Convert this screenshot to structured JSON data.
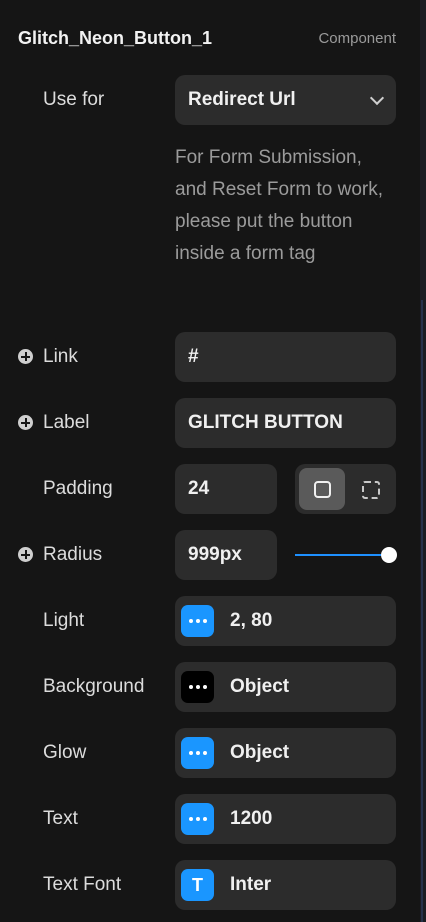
{
  "header": {
    "title": "Glitch_Neon_Button_1",
    "kind": "Component"
  },
  "use_for": {
    "label": "Use for",
    "value": "Redirect Url",
    "icon": "chevron-down-icon"
  },
  "help_text": "For Form Submission, and Reset Form to work, please put the button inside a form tag",
  "link": {
    "label": "Link",
    "value": "#"
  },
  "label_prop": {
    "label": "Label",
    "value": "GLITCH BUTTON"
  },
  "padding": {
    "label": "Padding",
    "value": "24",
    "toggle_icons": [
      "rounded-square-icon",
      "dashed-square-icon"
    ]
  },
  "radius": {
    "label": "Radius",
    "value": "999px",
    "slider_level": 1.0
  },
  "light": {
    "label": "Light",
    "value": "2, 80",
    "swatch_color": "#1a96ff"
  },
  "background": {
    "label": "Background",
    "value": "Object",
    "swatch_color": "#000000"
  },
  "glow": {
    "label": "Glow",
    "value": "Object",
    "swatch_color": "#1a96ff"
  },
  "text": {
    "label": "Text",
    "value": "1200",
    "swatch_color": "#1a96ff"
  },
  "text_font": {
    "label": "Text Font",
    "value": "Inter",
    "icon_glyph": "T",
    "swatch_color": "#1a96ff"
  },
  "accent_color": "#1e90ff"
}
